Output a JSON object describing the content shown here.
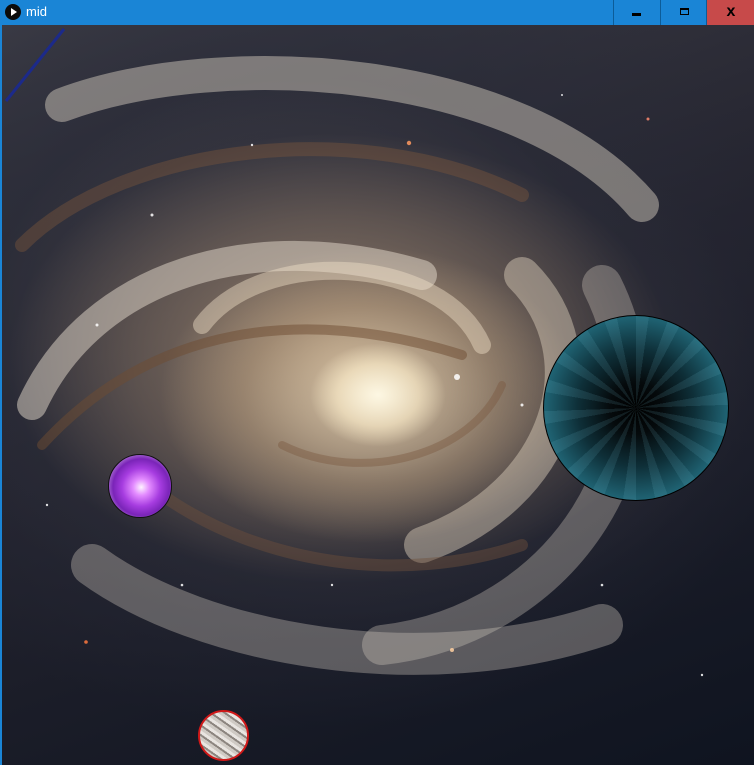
{
  "window": {
    "title": "mid",
    "app_icon": "play-icon",
    "controls": {
      "minimize_icon": "minimize-icon",
      "maximize_icon": "maximize-icon",
      "close_label": "x"
    }
  },
  "colors": {
    "titlebar": "#1a85d6",
    "close_button": "#c74a4a",
    "asteroid_ring": "#d01818"
  },
  "scene": {
    "background": "spiral-galaxy",
    "objects": [
      "black-hole",
      "purple-energy-orb",
      "asteroid"
    ]
  }
}
